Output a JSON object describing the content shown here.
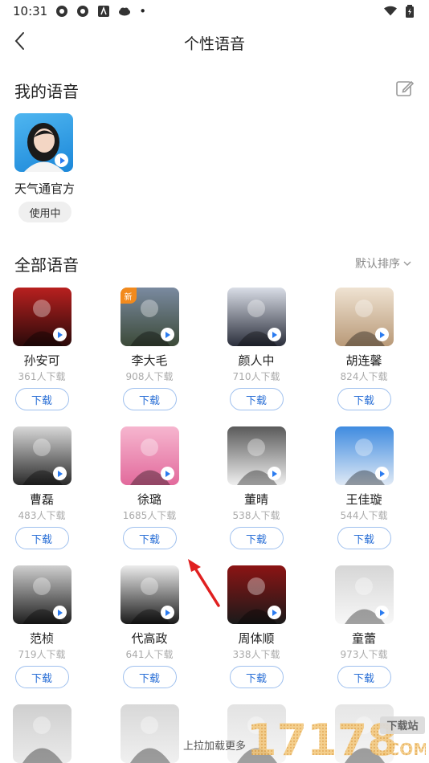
{
  "status_bar": {
    "time": "10:31",
    "dot": "•"
  },
  "nav": {
    "title": "个性语音"
  },
  "my_voice": {
    "section_title": "我的语音",
    "item": {
      "name": "天气通官方",
      "status": "使用中"
    }
  },
  "all_voices": {
    "section_title": "全部语音",
    "sort_label": "默认排序",
    "download_label": "下载",
    "new_badge": "新",
    "items": [
      {
        "name": "孙安可",
        "downloads": "361人下载",
        "bg": [
          "#b8201f",
          "#2a0a0a"
        ]
      },
      {
        "name": "李大毛",
        "downloads": "908人下载",
        "bg": [
          "#7a8aa0",
          "#3c4a38"
        ]
      },
      {
        "name": "颜人中",
        "downloads": "710人下载",
        "bg": [
          "#d9dde6",
          "#2b2f3c"
        ]
      },
      {
        "name": "胡连馨",
        "downloads": "824人下载",
        "bg": [
          "#efe3d2",
          "#b99a78"
        ]
      },
      {
        "name": "曹磊",
        "downloads": "483人下载",
        "bg": [
          "#d8d8d8",
          "#2a2a2a"
        ]
      },
      {
        "name": "徐璐",
        "downloads": "1685人下载",
        "bg": [
          "#f6b6cf",
          "#e26a9c"
        ]
      },
      {
        "name": "董晴",
        "downloads": "538人下载",
        "bg": [
          "#5a5a5a",
          "#efefef"
        ]
      },
      {
        "name": "王佳璇",
        "downloads": "544人下载",
        "bg": [
          "#3f8be0",
          "#dfe9f5"
        ]
      },
      {
        "name": "范桢",
        "downloads": "719人下载",
        "bg": [
          "#cfcfcf",
          "#1e1e1e"
        ]
      },
      {
        "name": "代高政",
        "downloads": "641人下载",
        "bg": [
          "#ececec",
          "#1a1a1a"
        ]
      },
      {
        "name": "周体顺",
        "downloads": "338人下载",
        "bg": [
          "#8c1414",
          "#1a1a1a"
        ]
      },
      {
        "name": "童蕾",
        "downloads": "973人下载",
        "bg": [
          "#d6d6d6",
          "#f7f7f7"
        ]
      },
      {
        "name": "",
        "downloads": "",
        "bg": [
          "#cfcfcf",
          "#eaeaea"
        ]
      },
      {
        "name": "",
        "downloads": "",
        "bg": [
          "#d8d8d8",
          "#f0f0f0"
        ]
      },
      {
        "name": "",
        "downloads": "",
        "bg": [
          "#e3e3e3",
          "#f5f5f5"
        ]
      },
      {
        "name": "",
        "downloads": "",
        "bg": [
          "#e6e6e6",
          "#f5f5f5"
        ]
      }
    ]
  },
  "load_more": "上拉加载更多",
  "watermark": {
    "number": "17178",
    "badge": "下载站",
    "suffix": ".COM"
  },
  "colors": {
    "accent": "#2a7bf0",
    "download_border": "#9fc0ee",
    "new_badge": "#f28a1d",
    "annotation_arrow": "#e02020"
  }
}
